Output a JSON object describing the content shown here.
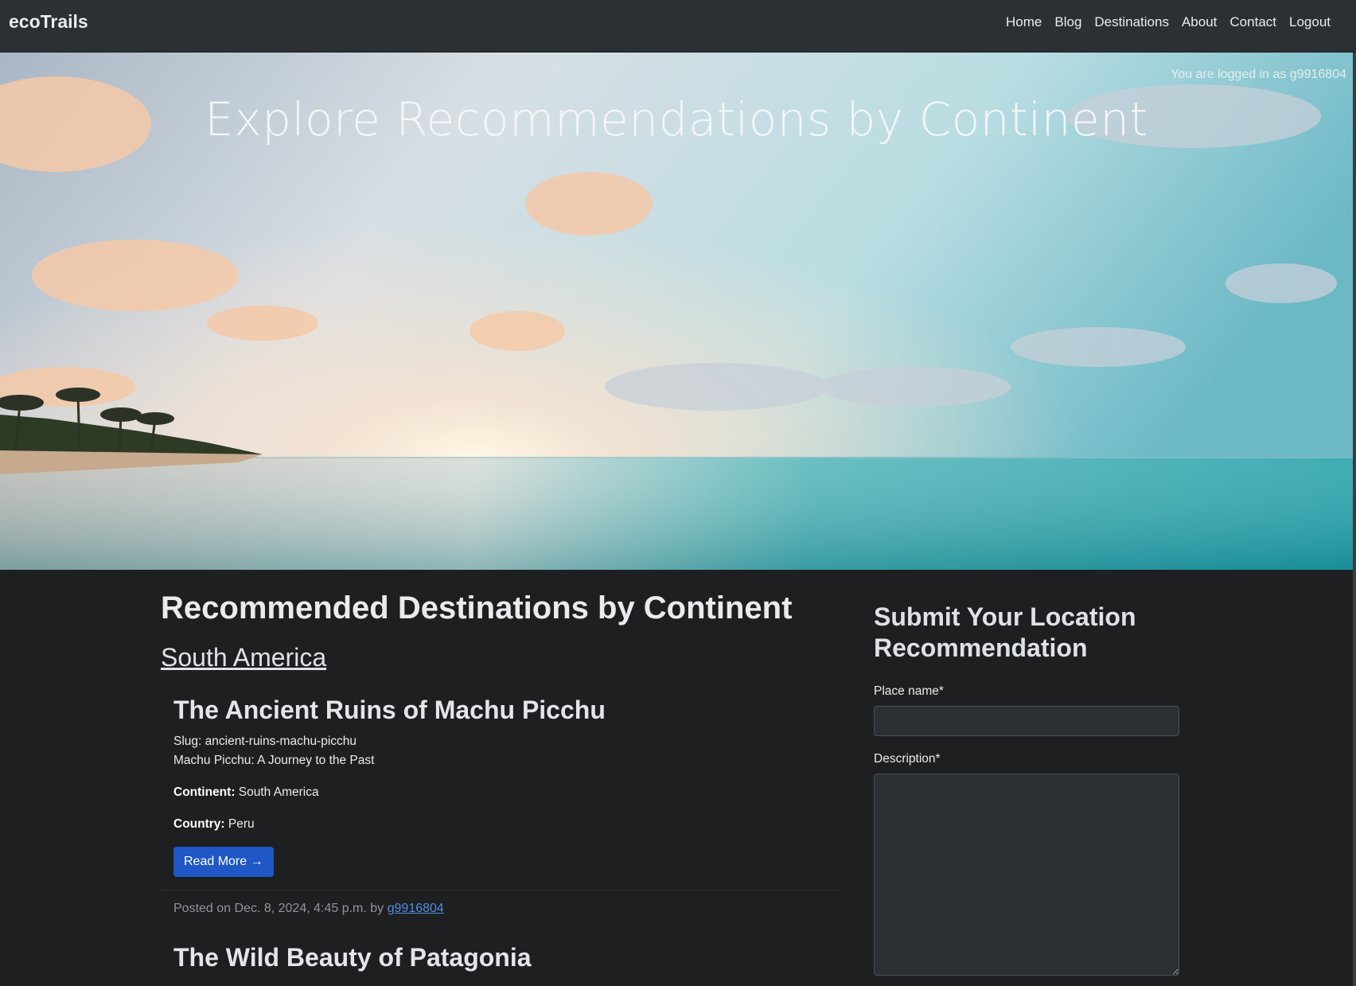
{
  "navbar": {
    "brand": "ecoTrails",
    "links": [
      "Home",
      "Blog",
      "Destinations",
      "About",
      "Contact",
      "Logout"
    ]
  },
  "hero": {
    "logged_in_text": "You are logged in as g9916804",
    "title": "Explore Recommendations by Continent"
  },
  "main": {
    "heading": "Recommended Destinations by Continent",
    "continent": "South America",
    "posts": [
      {
        "title": "The Ancient Ruins of Machu Picchu",
        "slug_line": "Slug: ancient-ruins-machu-picchu",
        "subtitle": "Machu Picchu: A Journey to the Past",
        "continent_label": "Continent:",
        "continent_value": "South America",
        "country_label": "Country:",
        "country_value": "Peru",
        "read_more": "Read More →",
        "posted_prefix": "Posted on Dec. 8, 2024, 4:45 p.m. by",
        "author": "g9916804"
      },
      {
        "title": "The Wild Beauty of Patagonia"
      }
    ]
  },
  "sidebar": {
    "heading": "Submit Your Location Recommendation",
    "place_label": "Place name*",
    "description_label": "Description*"
  }
}
